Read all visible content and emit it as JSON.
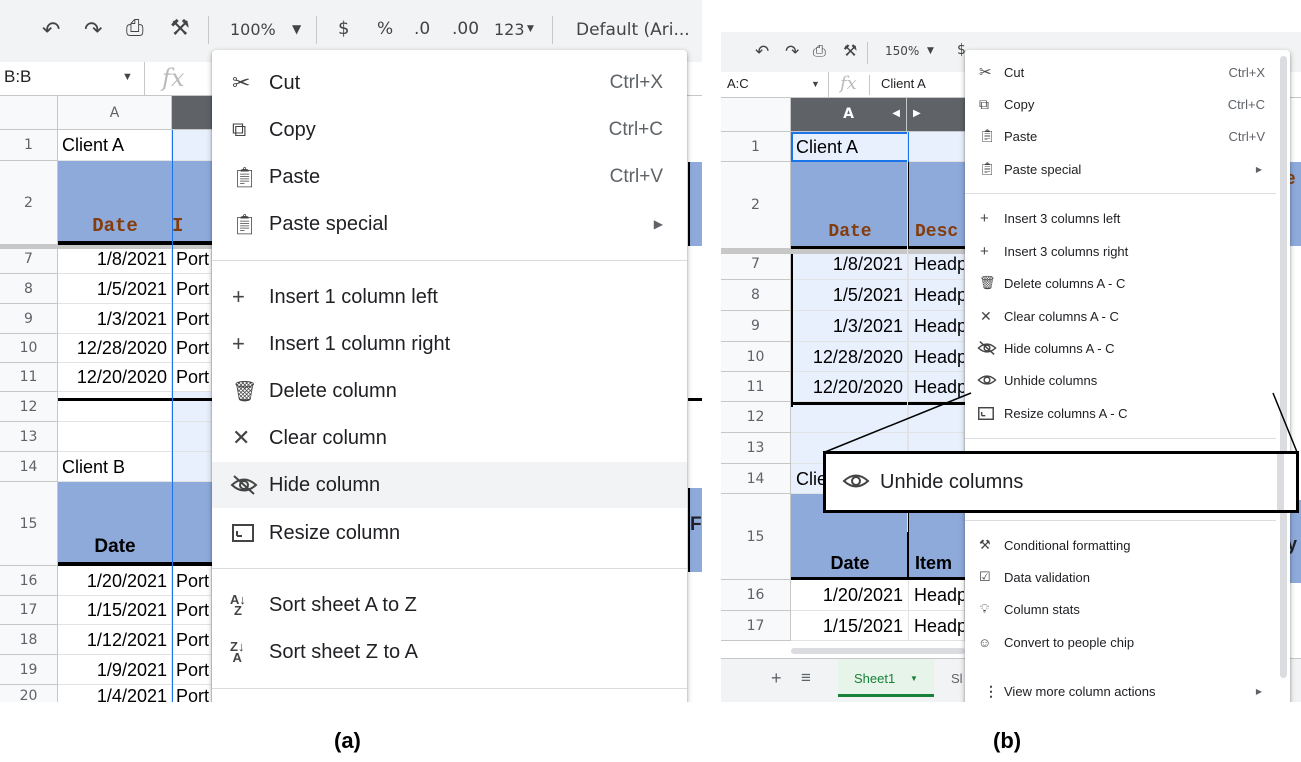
{
  "panel_a": {
    "toolbar": {
      "zoom": "100%",
      "currency": "$",
      "percent": "%",
      "dec_less": ".0",
      "dec_more": ".00",
      "format": "123",
      "font": "Default (Ari..."
    },
    "name_box": "B:B",
    "fx": "fx",
    "col_a": "A",
    "rows": [
      {
        "num": "1",
        "a": "Client A",
        "b": ""
      },
      {
        "num": "2",
        "a": "Date",
        "b": "I"
      },
      {
        "num": "7",
        "a": "1/8/2021",
        "b": "Port"
      },
      {
        "num": "8",
        "a": "1/5/2021",
        "b": "Port"
      },
      {
        "num": "9",
        "a": "1/3/2021",
        "b": "Port"
      },
      {
        "num": "10",
        "a": "12/28/2020",
        "b": "Port"
      },
      {
        "num": "11",
        "a": "12/20/2020",
        "b": "Port"
      },
      {
        "num": "12",
        "a": "",
        "b": ""
      },
      {
        "num": "13",
        "a": "",
        "b": ""
      },
      {
        "num": "14",
        "a": "Client B",
        "b": ""
      },
      {
        "num": "15",
        "a": "Date",
        "b": ""
      },
      {
        "num": "16",
        "a": "1/20/2021",
        "b": "Port"
      },
      {
        "num": "17",
        "a": "1/15/2021",
        "b": "Port"
      },
      {
        "num": "18",
        "a": "1/12/2021",
        "b": "Port"
      },
      {
        "num": "19",
        "a": "1/9/2021",
        "b": "Port"
      },
      {
        "num": "20",
        "a": "1/4/2021",
        "b": "Port"
      }
    ],
    "edge_text": "F",
    "menu": {
      "cut": {
        "label": "Cut",
        "shortcut": "Ctrl+X"
      },
      "copy": {
        "label": "Copy",
        "shortcut": "Ctrl+C"
      },
      "paste": {
        "label": "Paste",
        "shortcut": "Ctrl+V"
      },
      "paste_special": {
        "label": "Paste special"
      },
      "insert_left": {
        "label": "Insert 1 column left"
      },
      "insert_right": {
        "label": "Insert 1 column right"
      },
      "delete": {
        "label": "Delete column"
      },
      "clear": {
        "label": "Clear column"
      },
      "hide": {
        "label": "Hide column"
      },
      "resize": {
        "label": "Resize column"
      },
      "sort_az": {
        "label": "Sort sheet A to Z"
      },
      "sort_za": {
        "label": "Sort sheet Z to A"
      }
    },
    "caption": "(a)"
  },
  "panel_b": {
    "toolbar": {
      "zoom": "150%",
      "currency": "$"
    },
    "name_box": "A:C",
    "fx": "fx",
    "formula": "Client A",
    "col_a": "A",
    "rows": [
      {
        "num": "1",
        "a": "Client A",
        "b": ""
      },
      {
        "num": "2",
        "a": "Date",
        "b": "Desc"
      },
      {
        "num": "7",
        "a": "1/8/2021",
        "b": "Headp"
      },
      {
        "num": "8",
        "a": "1/5/2021",
        "b": "Headp"
      },
      {
        "num": "9",
        "a": "1/3/2021",
        "b": "Headp"
      },
      {
        "num": "10",
        "a": "12/28/2020",
        "b": "Headp"
      },
      {
        "num": "11",
        "a": "12/20/2020",
        "b": "Headp"
      },
      {
        "num": "12",
        "a": "",
        "b": ""
      },
      {
        "num": "13",
        "a": "",
        "b": ""
      },
      {
        "num": "14",
        "a": "Clie",
        "b": ""
      },
      {
        "num": "15",
        "a": "Date",
        "b": "Item"
      },
      {
        "num": "16",
        "a": "1/20/2021",
        "b": "Headp"
      },
      {
        "num": "17",
        "a": "1/15/2021",
        "b": "Headp"
      }
    ],
    "edge_top": "e",
    "edge_mid": "y",
    "menu": {
      "cut": {
        "label": "Cut",
        "shortcut": "Ctrl+X"
      },
      "copy": {
        "label": "Copy",
        "shortcut": "Ctrl+C"
      },
      "paste": {
        "label": "Paste",
        "shortcut": "Ctrl+V"
      },
      "paste_special": {
        "label": "Paste special"
      },
      "insert_left": {
        "label": "Insert 3 columns left"
      },
      "insert_right": {
        "label": "Insert 3 columns right"
      },
      "delete": {
        "label": "Delete columns A - C"
      },
      "clear": {
        "label": "Clear columns A - C"
      },
      "hide": {
        "label": "Hide columns A - C"
      },
      "unhide": {
        "label": "Unhide columns"
      },
      "resize": {
        "label": "Resize columns A - C"
      },
      "cond": {
        "label": "Conditional formatting"
      },
      "valid": {
        "label": "Data validation"
      },
      "stats": {
        "label": "Column stats"
      },
      "chip": {
        "label": "Convert to people chip"
      },
      "more": {
        "label": "View more column actions"
      }
    },
    "callout": {
      "label": "Unhide columns"
    },
    "sheet_tab": "Sheet1",
    "sheet_tab2": "Sl",
    "caption": "(b)"
  }
}
